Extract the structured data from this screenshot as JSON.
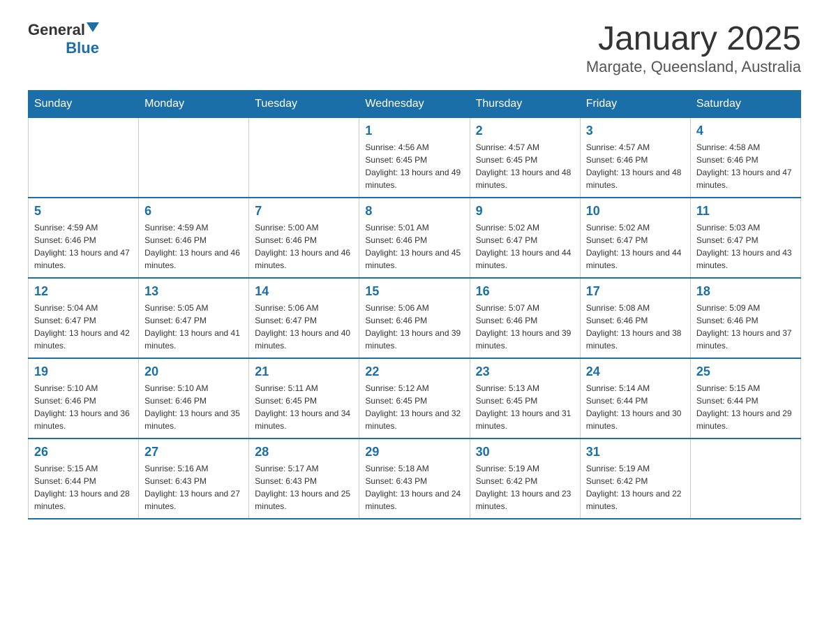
{
  "header": {
    "title": "January 2025",
    "subtitle": "Margate, Queensland, Australia",
    "logo_general": "General",
    "logo_blue": "Blue"
  },
  "days_of_week": [
    "Sunday",
    "Monday",
    "Tuesday",
    "Wednesday",
    "Thursday",
    "Friday",
    "Saturday"
  ],
  "weeks": [
    {
      "days": [
        {
          "number": "",
          "info": ""
        },
        {
          "number": "",
          "info": ""
        },
        {
          "number": "",
          "info": ""
        },
        {
          "number": "1",
          "info": "Sunrise: 4:56 AM\nSunset: 6:45 PM\nDaylight: 13 hours and 49 minutes."
        },
        {
          "number": "2",
          "info": "Sunrise: 4:57 AM\nSunset: 6:45 PM\nDaylight: 13 hours and 48 minutes."
        },
        {
          "number": "3",
          "info": "Sunrise: 4:57 AM\nSunset: 6:46 PM\nDaylight: 13 hours and 48 minutes."
        },
        {
          "number": "4",
          "info": "Sunrise: 4:58 AM\nSunset: 6:46 PM\nDaylight: 13 hours and 47 minutes."
        }
      ]
    },
    {
      "days": [
        {
          "number": "5",
          "info": "Sunrise: 4:59 AM\nSunset: 6:46 PM\nDaylight: 13 hours and 47 minutes."
        },
        {
          "number": "6",
          "info": "Sunrise: 4:59 AM\nSunset: 6:46 PM\nDaylight: 13 hours and 46 minutes."
        },
        {
          "number": "7",
          "info": "Sunrise: 5:00 AM\nSunset: 6:46 PM\nDaylight: 13 hours and 46 minutes."
        },
        {
          "number": "8",
          "info": "Sunrise: 5:01 AM\nSunset: 6:46 PM\nDaylight: 13 hours and 45 minutes."
        },
        {
          "number": "9",
          "info": "Sunrise: 5:02 AM\nSunset: 6:47 PM\nDaylight: 13 hours and 44 minutes."
        },
        {
          "number": "10",
          "info": "Sunrise: 5:02 AM\nSunset: 6:47 PM\nDaylight: 13 hours and 44 minutes."
        },
        {
          "number": "11",
          "info": "Sunrise: 5:03 AM\nSunset: 6:47 PM\nDaylight: 13 hours and 43 minutes."
        }
      ]
    },
    {
      "days": [
        {
          "number": "12",
          "info": "Sunrise: 5:04 AM\nSunset: 6:47 PM\nDaylight: 13 hours and 42 minutes."
        },
        {
          "number": "13",
          "info": "Sunrise: 5:05 AM\nSunset: 6:47 PM\nDaylight: 13 hours and 41 minutes."
        },
        {
          "number": "14",
          "info": "Sunrise: 5:06 AM\nSunset: 6:47 PM\nDaylight: 13 hours and 40 minutes."
        },
        {
          "number": "15",
          "info": "Sunrise: 5:06 AM\nSunset: 6:46 PM\nDaylight: 13 hours and 39 minutes."
        },
        {
          "number": "16",
          "info": "Sunrise: 5:07 AM\nSunset: 6:46 PM\nDaylight: 13 hours and 39 minutes."
        },
        {
          "number": "17",
          "info": "Sunrise: 5:08 AM\nSunset: 6:46 PM\nDaylight: 13 hours and 38 minutes."
        },
        {
          "number": "18",
          "info": "Sunrise: 5:09 AM\nSunset: 6:46 PM\nDaylight: 13 hours and 37 minutes."
        }
      ]
    },
    {
      "days": [
        {
          "number": "19",
          "info": "Sunrise: 5:10 AM\nSunset: 6:46 PM\nDaylight: 13 hours and 36 minutes."
        },
        {
          "number": "20",
          "info": "Sunrise: 5:10 AM\nSunset: 6:46 PM\nDaylight: 13 hours and 35 minutes."
        },
        {
          "number": "21",
          "info": "Sunrise: 5:11 AM\nSunset: 6:45 PM\nDaylight: 13 hours and 34 minutes."
        },
        {
          "number": "22",
          "info": "Sunrise: 5:12 AM\nSunset: 6:45 PM\nDaylight: 13 hours and 32 minutes."
        },
        {
          "number": "23",
          "info": "Sunrise: 5:13 AM\nSunset: 6:45 PM\nDaylight: 13 hours and 31 minutes."
        },
        {
          "number": "24",
          "info": "Sunrise: 5:14 AM\nSunset: 6:44 PM\nDaylight: 13 hours and 30 minutes."
        },
        {
          "number": "25",
          "info": "Sunrise: 5:15 AM\nSunset: 6:44 PM\nDaylight: 13 hours and 29 minutes."
        }
      ]
    },
    {
      "days": [
        {
          "number": "26",
          "info": "Sunrise: 5:15 AM\nSunset: 6:44 PM\nDaylight: 13 hours and 28 minutes."
        },
        {
          "number": "27",
          "info": "Sunrise: 5:16 AM\nSunset: 6:43 PM\nDaylight: 13 hours and 27 minutes."
        },
        {
          "number": "28",
          "info": "Sunrise: 5:17 AM\nSunset: 6:43 PM\nDaylight: 13 hours and 25 minutes."
        },
        {
          "number": "29",
          "info": "Sunrise: 5:18 AM\nSunset: 6:43 PM\nDaylight: 13 hours and 24 minutes."
        },
        {
          "number": "30",
          "info": "Sunrise: 5:19 AM\nSunset: 6:42 PM\nDaylight: 13 hours and 23 minutes."
        },
        {
          "number": "31",
          "info": "Sunrise: 5:19 AM\nSunset: 6:42 PM\nDaylight: 13 hours and 22 minutes."
        },
        {
          "number": "",
          "info": ""
        }
      ]
    }
  ]
}
